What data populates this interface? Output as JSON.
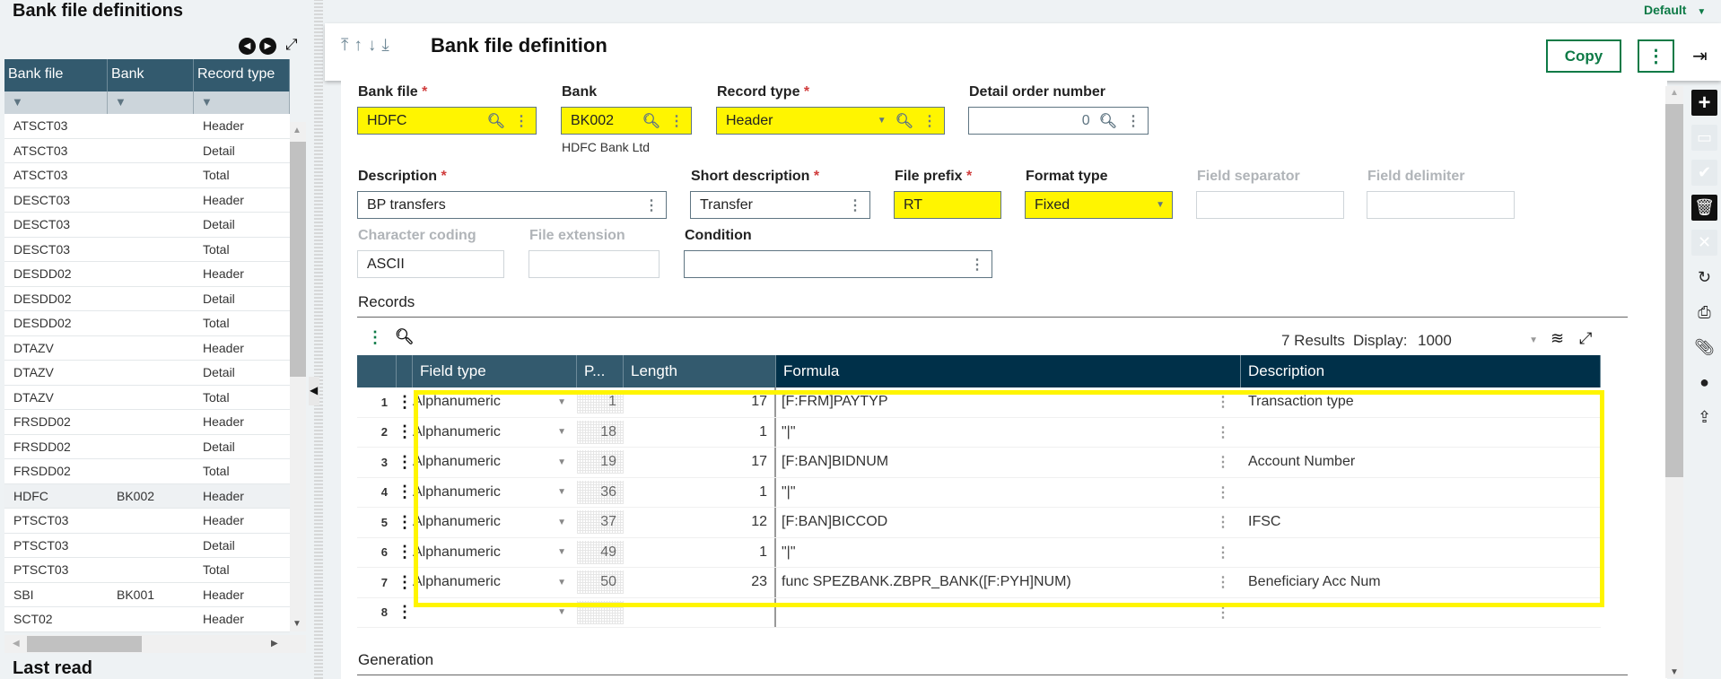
{
  "left_panel": {
    "title": "Bank file definitions",
    "columns": [
      "Bank file",
      "Bank",
      "Record type"
    ],
    "rows": [
      {
        "bank_file": "ATSCT03",
        "bank": "",
        "record_type": "Header"
      },
      {
        "bank_file": "ATSCT03",
        "bank": "",
        "record_type": "Detail"
      },
      {
        "bank_file": "ATSCT03",
        "bank": "",
        "record_type": "Total"
      },
      {
        "bank_file": "DESCT03",
        "bank": "",
        "record_type": "Header"
      },
      {
        "bank_file": "DESCT03",
        "bank": "",
        "record_type": "Detail"
      },
      {
        "bank_file": "DESCT03",
        "bank": "",
        "record_type": "Total"
      },
      {
        "bank_file": "DESDD02",
        "bank": "",
        "record_type": "Header"
      },
      {
        "bank_file": "DESDD02",
        "bank": "",
        "record_type": "Detail"
      },
      {
        "bank_file": "DESDD02",
        "bank": "",
        "record_type": "Total"
      },
      {
        "bank_file": "DTAZV",
        "bank": "",
        "record_type": "Header"
      },
      {
        "bank_file": "DTAZV",
        "bank": "",
        "record_type": "Detail"
      },
      {
        "bank_file": "DTAZV",
        "bank": "",
        "record_type": "Total"
      },
      {
        "bank_file": "FRSDD02",
        "bank": "",
        "record_type": "Header"
      },
      {
        "bank_file": "FRSDD02",
        "bank": "",
        "record_type": "Detail"
      },
      {
        "bank_file": "FRSDD02",
        "bank": "",
        "record_type": "Total"
      },
      {
        "bank_file": "HDFC",
        "bank": "BK002",
        "record_type": "Header",
        "selected": true
      },
      {
        "bank_file": "PTSCT03",
        "bank": "",
        "record_type": "Header"
      },
      {
        "bank_file": "PTSCT03",
        "bank": "",
        "record_type": "Detail"
      },
      {
        "bank_file": "PTSCT03",
        "bank": "",
        "record_type": "Total"
      },
      {
        "bank_file": "SBI",
        "bank": "BK001",
        "record_type": "Header"
      },
      {
        "bank_file": "SCT02",
        "bank": "",
        "record_type": "Header"
      }
    ],
    "last_read_title": "Last read"
  },
  "topbar": {
    "profile": "Default"
  },
  "header": {
    "title": "Bank file definition",
    "copy_label": "Copy",
    "more_label": "⋮"
  },
  "form": {
    "bank_file": {
      "label": "Bank file",
      "value": "HDFC"
    },
    "bank": {
      "label": "Bank",
      "value": "BK002",
      "subtitle": "HDFC Bank Ltd"
    },
    "record_type": {
      "label": "Record type",
      "value": "Header"
    },
    "detail_order": {
      "label": "Detail order number",
      "value": "0"
    },
    "description": {
      "label": "Description",
      "value": "BP transfers"
    },
    "short_description": {
      "label": "Short description",
      "value": "Transfer"
    },
    "file_prefix": {
      "label": "File prefix",
      "value": "RT"
    },
    "format_type": {
      "label": "Format type",
      "value": "Fixed"
    },
    "field_separator": {
      "label": "Field separator",
      "value": ""
    },
    "field_delimiter": {
      "label": "Field delimiter",
      "value": ""
    },
    "character_coding": {
      "label": "Character coding",
      "value": "ASCII"
    },
    "file_extension": {
      "label": "File extension",
      "value": ""
    },
    "condition": {
      "label": "Condition",
      "value": ""
    }
  },
  "records": {
    "title": "Records",
    "results": "7 Results",
    "display_label": "Display:",
    "display_value": "1000",
    "columns": [
      "Field type",
      "P...",
      "Length",
      "Formula",
      "Description"
    ],
    "rows": [
      {
        "n": "1",
        "field_type": "Alphanumeric",
        "pos": "1",
        "length": "17",
        "formula": "[F:FRM]PAYTYP",
        "description": "Transaction type"
      },
      {
        "n": "2",
        "field_type": "Alphanumeric",
        "pos": "18",
        "length": "1",
        "formula": "\"|\"",
        "description": ""
      },
      {
        "n": "3",
        "field_type": "Alphanumeric",
        "pos": "19",
        "length": "17",
        "formula": "[F:BAN]BIDNUM",
        "description": "Account Number"
      },
      {
        "n": "4",
        "field_type": "Alphanumeric",
        "pos": "36",
        "length": "1",
        "formula": "\"|\"",
        "description": ""
      },
      {
        "n": "5",
        "field_type": "Alphanumeric",
        "pos": "37",
        "length": "12",
        "formula": "[F:BAN]BICCOD",
        "description": "IFSC"
      },
      {
        "n": "6",
        "field_type": "Alphanumeric",
        "pos": "49",
        "length": "1",
        "formula": "\"|\"",
        "description": ""
      },
      {
        "n": "7",
        "field_type": "Alphanumeric",
        "pos": "50",
        "length": "23",
        "formula": "func SPEZBANK.ZBPR_BANK([F:PYH]NUM)",
        "description": "Beneficiary Acc Num"
      },
      {
        "n": "8",
        "field_type": "",
        "pos": "",
        "length": "",
        "formula": "",
        "description": ""
      }
    ]
  },
  "generation": {
    "title": "Generation"
  },
  "colors": {
    "accent": "#0d7a46",
    "grid_header": "#335a6e",
    "grid_header_dark": "#003049",
    "highlight": "#fff500"
  }
}
